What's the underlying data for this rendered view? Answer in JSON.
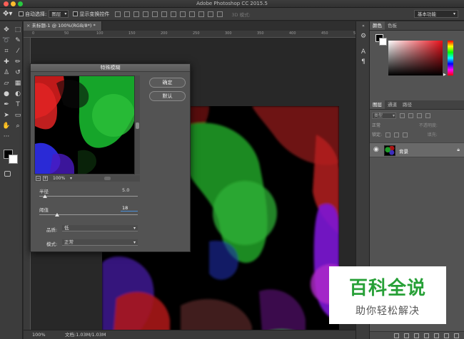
{
  "app": {
    "title": "Adobe Photoshop CC 2015.5"
  },
  "options_bar": {
    "auto_select_label": "自动选择:",
    "auto_select_value": "图层",
    "show_transform_label": "显示变换控件",
    "mode3d_label": "3D 模式:",
    "workspace_value": "基本功能"
  },
  "document": {
    "tab_label": "未标题-1 @ 100%(RGB/8*) *",
    "ruler_ticks": [
      "0",
      "50",
      "100",
      "150",
      "200",
      "250",
      "300",
      "350",
      "400",
      "450",
      "500"
    ]
  },
  "statusbar": {
    "zoom": "100%",
    "doc_info": "文档:1.03M/1.03M"
  },
  "dialog": {
    "title": "特殊模糊",
    "ok_label": "确定",
    "reset_label": "默认",
    "preview_zoom": "100%",
    "radius_label": "半径",
    "radius_value": "5.0",
    "radius_level": 0.06,
    "threshold_label": "阈值",
    "threshold_value": "18",
    "threshold_level": 0.18,
    "quality_label": "品质:",
    "quality_value": "低",
    "mode_label": "模式:",
    "mode_value": "正常"
  },
  "right_panels": {
    "color_tabs": [
      "颜色",
      "色板"
    ],
    "layer_tabs": [
      "图层",
      "通道",
      "路径"
    ],
    "kind_label": "类型",
    "blend_mode": "正常",
    "opacity_label": "不透明度:",
    "lock_label": "锁定:",
    "fill_label": "填充:",
    "layer_name": "背景"
  },
  "watermark": {
    "title": "百科全说",
    "subtitle": "助你轻松解决"
  },
  "colors": {
    "foreground": "#000000",
    "background": "#ffffff",
    "hue": "#e8101a",
    "accent_green": "#27a037",
    "input_focus": "#4a8fd8"
  },
  "tool_icons": [
    "move-tool-icon",
    "artboard-icon",
    "marquee-tool-icon",
    "lasso-tool-icon",
    "quick-select-icon",
    "crop-tool-icon",
    "eyedropper-icon",
    "healing-brush-icon",
    "brush-tool-icon",
    "clone-stamp-icon",
    "history-brush-icon",
    "eraser-tool-icon",
    "gradient-tool-icon",
    "blur-tool-icon",
    "dodge-tool-icon",
    "pen-tool-icon",
    "type-tool-icon",
    "path-select-icon",
    "rectangle-tool-icon",
    "hand-tool-icon",
    "zoom-tool-icon",
    "more-tools-icon"
  ]
}
